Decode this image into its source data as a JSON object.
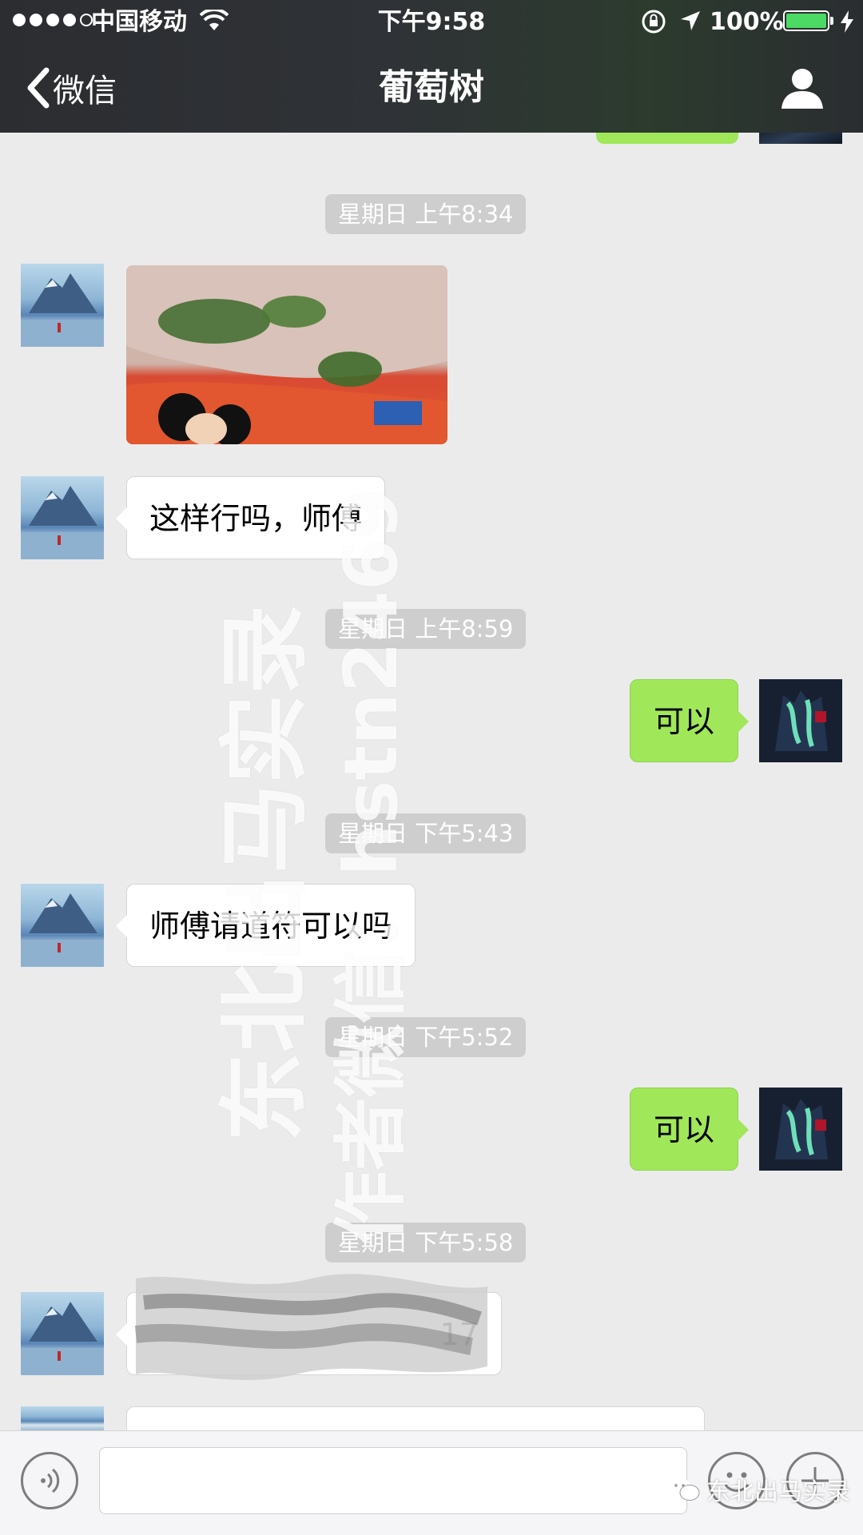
{
  "status_bar": {
    "carrier": "中国移动",
    "time": "下午9:58",
    "battery": "100%",
    "battery_level": 1.0,
    "signal_bars": 4
  },
  "nav": {
    "back_label": "微信",
    "title": "葡萄树"
  },
  "messages": {
    "ts1": "星期日 上午8:34",
    "msg1_text": "这样行吗，师傅",
    "ts2": "星期日 上午8:59",
    "msg2_text": "可以",
    "ts3": "星期日 下午5:43",
    "msg3_text": "师傅请道符可以吗",
    "ts4": "星期日 下午5:52",
    "msg4_text": "可以",
    "ts5": "星期日 下午5:58",
    "msg5_visible_fragment": "17"
  },
  "watermark": {
    "line1": "东北出马实录",
    "line2": "作者微信：hstn2469"
  },
  "footer_brand": {
    "label": "东北出马实录"
  },
  "input": {
    "value": "",
    "placeholder": ""
  },
  "colors": {
    "nav_bg": "#2e3034",
    "chat_bg": "#ebebeb",
    "bubble_out": "#a0e75a",
    "bubble_in": "#ffffff",
    "timestamp_bg": "#cecece",
    "battery_green": "#4cd964"
  },
  "icons": [
    "wifi-icon",
    "rotation-lock-icon",
    "location-arrow-icon",
    "battery-icon",
    "charging-icon",
    "back-chevron-icon",
    "profile-icon",
    "voice-icon",
    "emoji-icon",
    "plus-icon",
    "wechat-logo-icon"
  ]
}
